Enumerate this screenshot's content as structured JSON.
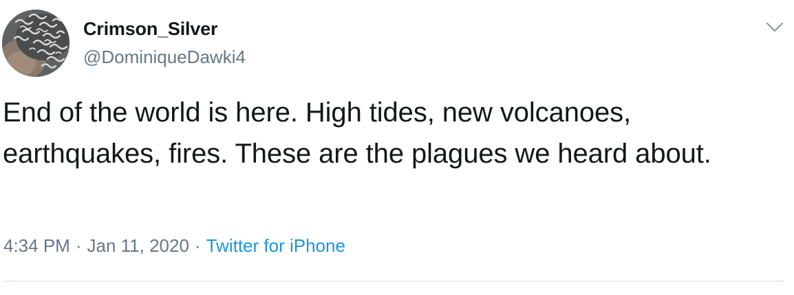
{
  "tweet": {
    "display_name": "Crimson_Silver",
    "handle": "@DominiqueDawki4",
    "avatar_icon": "profile-avatar",
    "more_icon": "chevron-down-icon",
    "text": "End of the world is here. High tides, new volcanoes, earthquakes, fires. These are the plagues we heard about.",
    "time": "4:34 PM",
    "separator": "·",
    "date": "Jan 11, 2020",
    "source": "Twitter for iPhone"
  },
  "colors": {
    "text_primary": "#14171a",
    "text_secondary": "#657786",
    "link": "#1b95e0",
    "divider": "#e6ecf0"
  }
}
